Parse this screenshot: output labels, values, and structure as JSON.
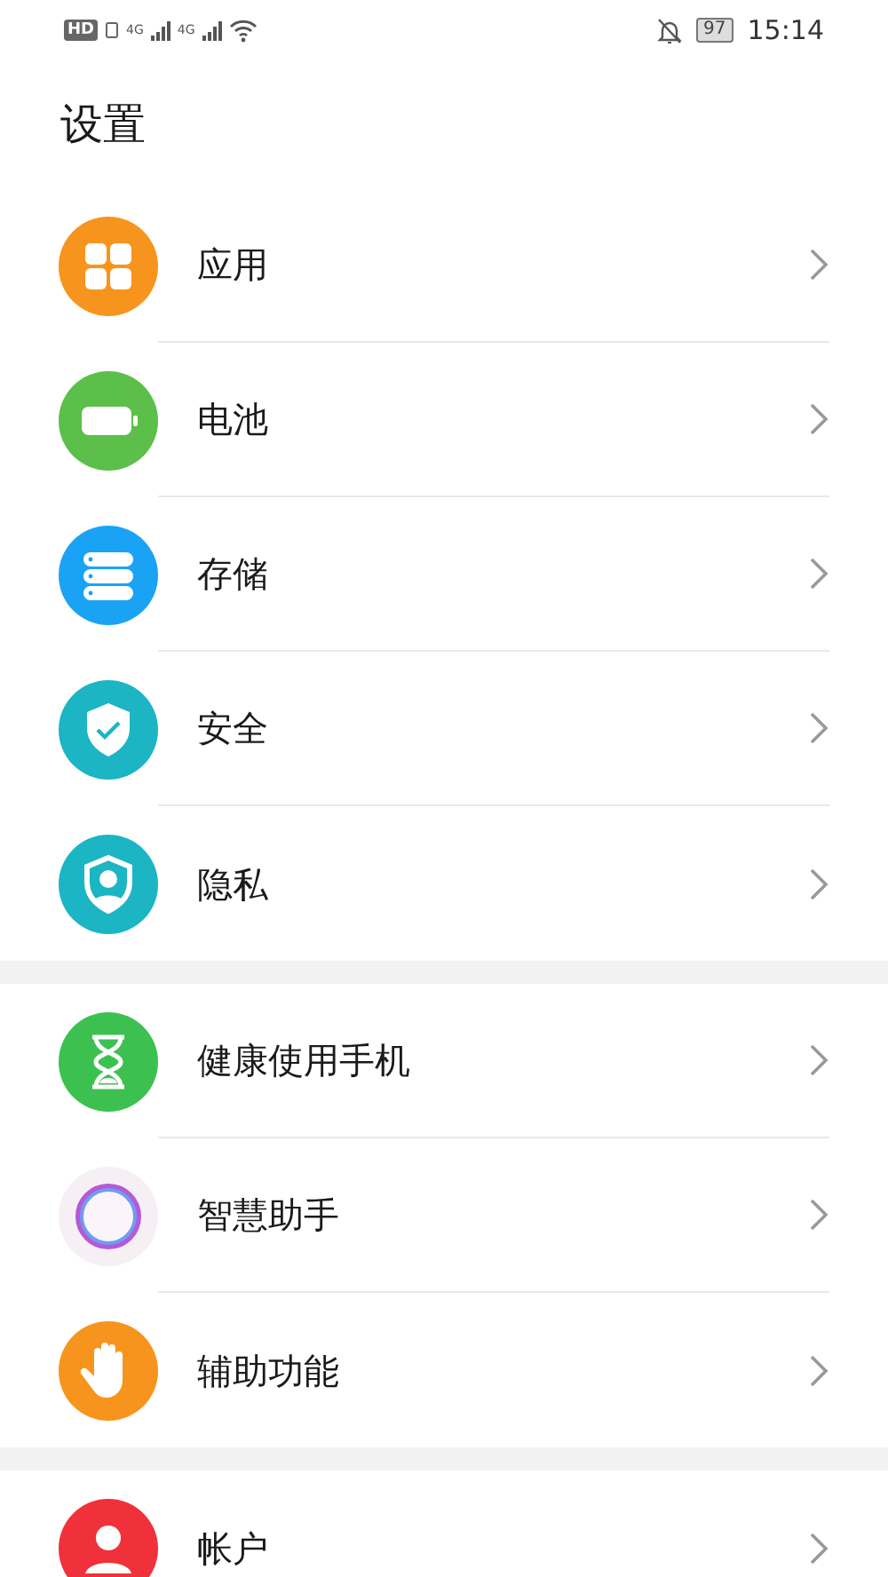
{
  "status_bar": {
    "hd": "HD",
    "networks": [
      "4G",
      "4G"
    ],
    "battery": "97",
    "time": "15:14"
  },
  "title": "设置",
  "groups": [
    {
      "items": [
        {
          "label": "应用",
          "kind": "apps"
        },
        {
          "label": "电池",
          "kind": "battery"
        },
        {
          "label": "存储",
          "kind": "storage"
        },
        {
          "label": "安全",
          "kind": "security"
        },
        {
          "label": "隐私",
          "kind": "privacy"
        }
      ]
    },
    {
      "items": [
        {
          "label": "健康使用手机",
          "kind": "hourglass"
        },
        {
          "label": "智慧助手",
          "kind": "assistant"
        },
        {
          "label": "辅助功能",
          "kind": "hand"
        }
      ]
    },
    {
      "items": [
        {
          "label": "帐户",
          "kind": "account"
        }
      ]
    }
  ]
}
